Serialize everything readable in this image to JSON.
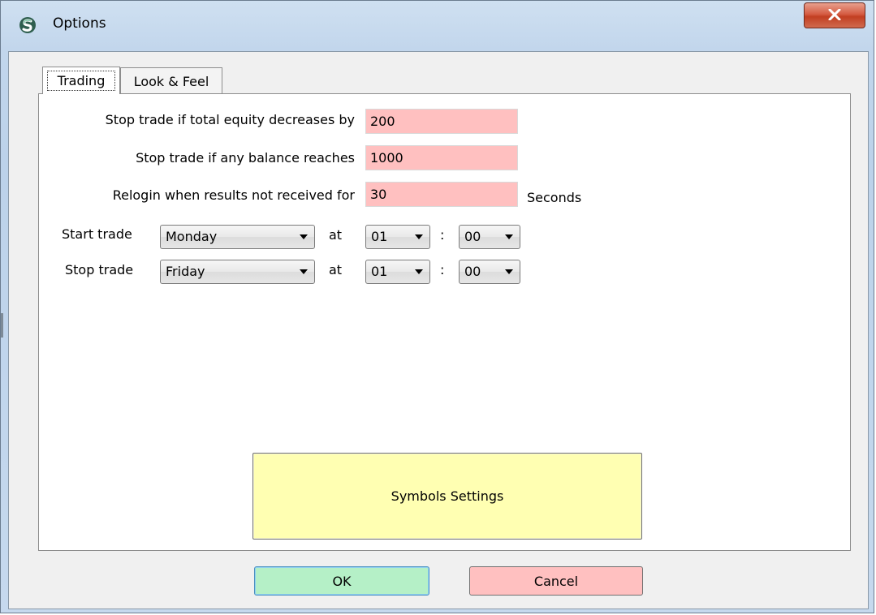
{
  "window": {
    "title": "Options",
    "close_label": "X"
  },
  "tabs": [
    {
      "label": "Trading",
      "active": true
    },
    {
      "label": "Look & Feel",
      "active": false
    }
  ],
  "trading": {
    "equity_label": "Stop trade if total equity decreases by",
    "equity_value": "200",
    "balance_label": "Stop trade if any balance reaches",
    "balance_value": "1000",
    "relogin_label": "Relogin when results not received for",
    "relogin_value": "30",
    "relogin_unit": "Seconds",
    "start": {
      "label": "Start trade",
      "day": "Monday",
      "at_label": "at",
      "hour": "01",
      "separator": ":",
      "minute": "00"
    },
    "stop": {
      "label": "Stop trade",
      "day": "Friday",
      "at_label": "at",
      "hour": "01",
      "separator": ":",
      "minute": "00"
    },
    "symbols_button": "Symbols Settings"
  },
  "footer": {
    "ok_label": "OK",
    "cancel_label": "Cancel"
  },
  "colors": {
    "input_background": "#ffc0c0",
    "symbols_button": "#ffffb2",
    "ok_button": "#b5f0c7",
    "cancel_button": "#ffc0c0"
  }
}
